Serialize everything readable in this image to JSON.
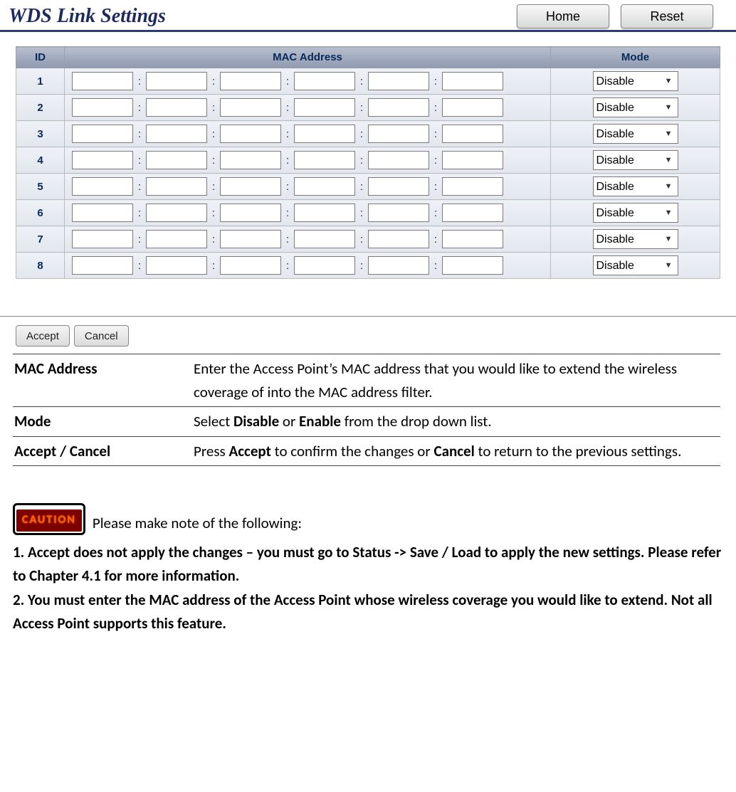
{
  "header": {
    "title": "WDS Link Settings",
    "home": "Home",
    "reset": "Reset"
  },
  "table": {
    "col_id": "ID",
    "col_mac": "MAC Address",
    "col_mode": "Mode",
    "sep": ":",
    "rows": [
      {
        "id": "1",
        "mac": [
          "",
          "",
          "",
          "",
          "",
          ""
        ],
        "mode": "Disable"
      },
      {
        "id": "2",
        "mac": [
          "",
          "",
          "",
          "",
          "",
          ""
        ],
        "mode": "Disable"
      },
      {
        "id": "3",
        "mac": [
          "",
          "",
          "",
          "",
          "",
          ""
        ],
        "mode": "Disable"
      },
      {
        "id": "4",
        "mac": [
          "",
          "",
          "",
          "",
          "",
          ""
        ],
        "mode": "Disable"
      },
      {
        "id": "5",
        "mac": [
          "",
          "",
          "",
          "",
          "",
          ""
        ],
        "mode": "Disable"
      },
      {
        "id": "6",
        "mac": [
          "",
          "",
          "",
          "",
          "",
          ""
        ],
        "mode": "Disable"
      },
      {
        "id": "7",
        "mac": [
          "",
          "",
          "",
          "",
          "",
          ""
        ],
        "mode": "Disable"
      },
      {
        "id": "8",
        "mac": [
          "",
          "",
          "",
          "",
          "",
          ""
        ],
        "mode": "Disable"
      }
    ]
  },
  "actions": {
    "accept": "Accept",
    "cancel": "Cancel"
  },
  "help": [
    {
      "term": "MAC Address",
      "desc": "Enter the Access Point’s MAC address that you would like to extend the wireless coverage of into the MAC address filter."
    },
    {
      "term": "Mode",
      "desc_pre": "Select ",
      "b1": "Disable",
      "mid": " or ",
      "b2": "Enable",
      "desc_post": " from the drop down list."
    },
    {
      "term": "Accept / Cancel",
      "desc_pre": "Press ",
      "b1": "Accept",
      "mid": " to confirm the changes or ",
      "b2": "Cancel",
      "desc_post": " to return to the previous settings."
    }
  ],
  "caution": {
    "badge": "CAUTION",
    "intro": "Please make note of the following:",
    "note1": "1. Accept does not apply the changes – you must go to Status -> Save / Load to apply the new settings. Please refer to Chapter 4.1 for more information.",
    "note2": "2. You must enter the MAC address of the Access Point whose wireless coverage you would like to extend. Not all Access Point supports this feature."
  }
}
